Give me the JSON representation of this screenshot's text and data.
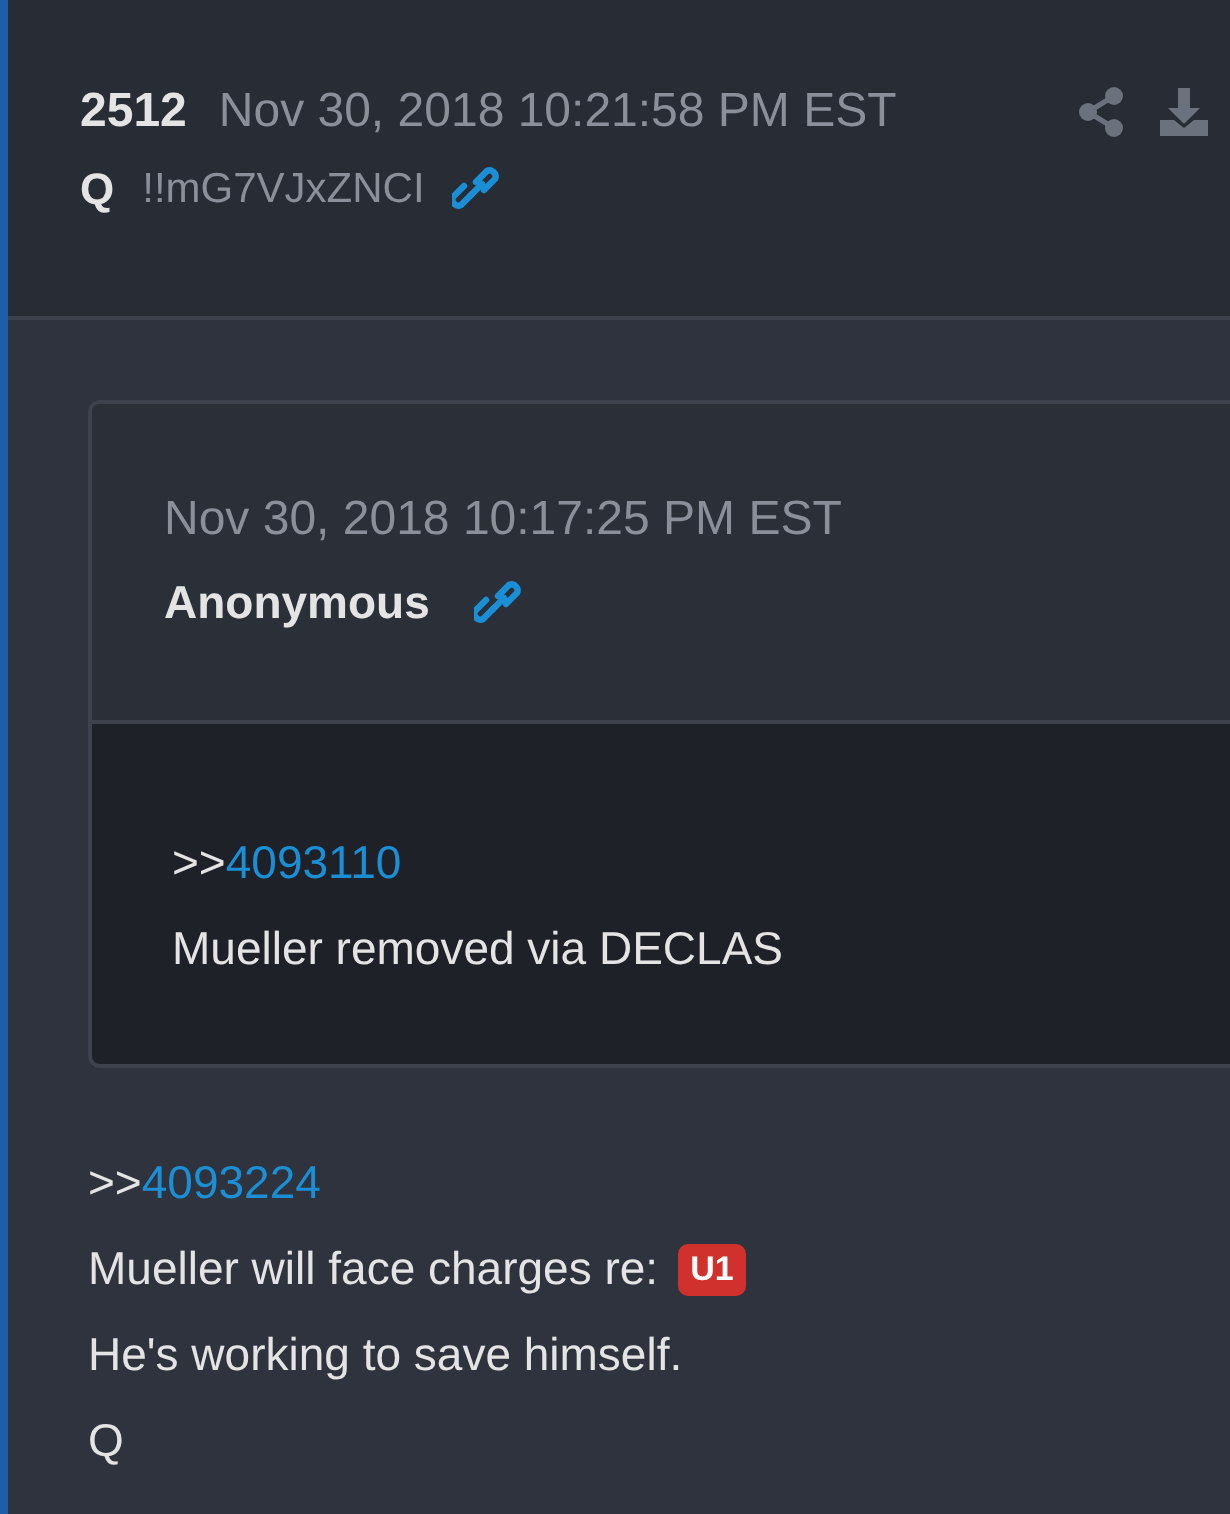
{
  "post": {
    "number": "2512",
    "date": "Nov 30, 2018 10:21:58 PM EST",
    "author": "Q",
    "tripcode": "!!mG7VJxZNCI"
  },
  "quote": {
    "date": "Nov 30, 2018 10:17:25 PM EST",
    "author": "Anonymous",
    "lines": [
      {
        "kind": "reply",
        "prefix": ">>",
        "ref": "4093110"
      },
      {
        "kind": "text",
        "text": "Mueller removed via DECLAS"
      }
    ]
  },
  "lines": [
    {
      "kind": "reply",
      "prefix": ">>",
      "ref": "4093224"
    },
    {
      "kind": "tagged",
      "text": "Mueller will face charges re:",
      "tag": {
        "text": "U1",
        "color": "#d0312d"
      }
    },
    {
      "kind": "text",
      "text": "He's working to save himself."
    },
    {
      "kind": "text",
      "text": "Q"
    }
  ]
}
